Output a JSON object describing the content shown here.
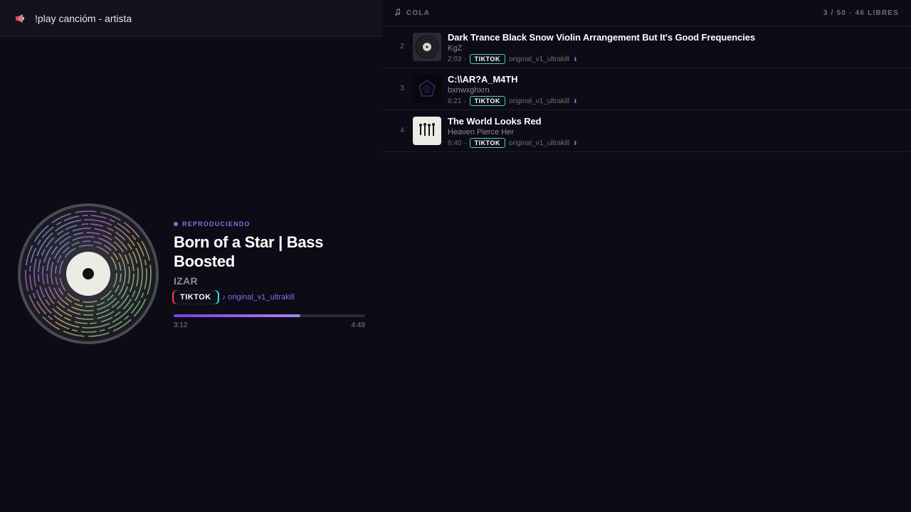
{
  "command_bar": {
    "icon": "megaphone-icon",
    "text": "!play canciόm - artista"
  },
  "now_playing": {
    "label": "REPRODUCIENDO",
    "title": "Born of a Star | Bass Boosted",
    "artist": "IZAR",
    "source_badge": "TIKTOK",
    "source_user": "♪ original_v1_ultrakill",
    "elapsed": "3:12",
    "duration": "4:49",
    "progress": 0.66
  },
  "queue": {
    "title": "COLA",
    "icon": "music-note-icon",
    "count": "3 / 50 · 46 LIBRES",
    "items": [
      {
        "number": "2",
        "title": "Dark Trance Black Snow Violin Arrangement But It's Good Frequencies",
        "artist": "KgZ",
        "duration": "2:03 ·",
        "badge": "TIKTOK",
        "user": "original_v1_ultrakill",
        "marker": "⬇",
        "thumb": "vinyl-thumb"
      },
      {
        "number": "3",
        "title": "C:\\\\AR?A_M4TH",
        "artist": "bxnwxghxrn",
        "duration": "6:21 ·",
        "badge": "TIKTOK",
        "user": "original_v1_ultrakill",
        "marker": "⬇",
        "thumb": "dark-thumb"
      },
      {
        "number": "4",
        "title": "The World Looks Red",
        "artist": "Heaven Pierce Her",
        "duration": "6:40 ·",
        "badge": "TIKTOK",
        "user": "original_v1_ultrakill",
        "marker": "⬇",
        "thumb": "figures-thumb"
      }
    ]
  },
  "colors": {
    "background": "#0c0b16",
    "accent": "#8f6be8",
    "badge_border": "#3fd4c4"
  }
}
